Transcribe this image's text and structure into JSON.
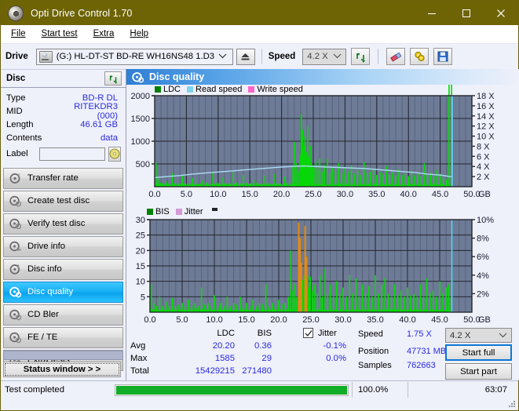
{
  "window": {
    "title": "Opti Drive Control 1.70",
    "icon": "disc-icon",
    "minimize": "minimize-icon",
    "maximize": "maximize-icon",
    "close": "close-icon",
    "titlebar_color": "#6e6405"
  },
  "menu": {
    "items": [
      {
        "label": "File",
        "accel": "F"
      },
      {
        "label": "Start test",
        "accel": "S"
      },
      {
        "label": "Extra",
        "accel": "x"
      },
      {
        "label": "Help",
        "accel": "H"
      }
    ]
  },
  "toolbar": {
    "drive_label": "Drive",
    "drive_value": "(G:)  HL-DT-ST BD-RE  WH16NS48 1.D3",
    "drive_icon": "optical-drive-icon",
    "eject_icon": "eject-icon",
    "speed_label": "Speed",
    "speed_value": "4.2 X",
    "refresh_icon": "refresh-icon",
    "eraser_icon": "eraser-icon",
    "settings_icon": "settings-icon",
    "save_icon": "save-icon"
  },
  "disc_panel": {
    "header": "Disc",
    "refresh_icon": "refresh-disc-icon",
    "rows": [
      {
        "key": "Type",
        "value": "BD-R DL"
      },
      {
        "key": "MID",
        "value": "RITEKDR3 (000)"
      },
      {
        "key": "Length",
        "value": "46.61 GB"
      },
      {
        "key": "Contents",
        "value": "data"
      }
    ],
    "label_key": "Label",
    "label_value": "",
    "label_placeholder": "",
    "label_button_icon": "disc-label-icon"
  },
  "sidebar": {
    "items": [
      {
        "label": "Transfer rate",
        "icon": "disc-test-icon",
        "active": false
      },
      {
        "label": "Create test disc",
        "icon": "disc-create-icon",
        "active": false
      },
      {
        "label": "Verify test disc",
        "icon": "disc-verify-icon",
        "active": false
      },
      {
        "label": "Drive info",
        "icon": "drive-info-icon",
        "active": false
      },
      {
        "label": "Disc info",
        "icon": "disc-info-icon",
        "active": false
      },
      {
        "label": "Disc quality",
        "icon": "disc-quality-icon",
        "active": true
      },
      {
        "label": "CD Bler",
        "icon": "cd-bler-icon",
        "active": false
      },
      {
        "label": "FE / TE",
        "icon": "fe-te-icon",
        "active": false
      },
      {
        "label": "Extra tests",
        "icon": "extra-tests-icon",
        "active": false
      }
    ],
    "status_window_button": "Status window > >"
  },
  "main": {
    "title": "Disc quality",
    "icon": "disc-quality-icon"
  },
  "chart_data": [
    {
      "type": "line",
      "name": "ldc-chart",
      "title": "",
      "xlabel": "GB",
      "ylabel": "",
      "xlim": [
        0,
        50
      ],
      "ylim": [
        0,
        2000
      ],
      "y2lim": [
        0,
        18
      ],
      "y2label": "X",
      "grid": true,
      "legend_position": "top-left",
      "legend": [
        {
          "name": "LDC",
          "color": "#008000"
        },
        {
          "name": "Read speed",
          "color": "#7fd4f0"
        },
        {
          "name": "Write speed",
          "color": "#ff66cc"
        }
      ],
      "xticks": [
        "0.0",
        "5.0",
        "10.0",
        "15.0",
        "20.0",
        "25.0",
        "30.0",
        "35.0",
        "40.0",
        "45.0",
        "50.0"
      ],
      "yticks": [
        500,
        1000,
        1500,
        2000
      ],
      "y2ticks": [
        "2 X",
        "4 X",
        "6 X",
        "8 X",
        "10 X",
        "12 X",
        "14 X",
        "16 X",
        "18 X"
      ],
      "series": [
        {
          "name": "LDC",
          "color": "#00dd00",
          "x": [
            0.2,
            0.5,
            0.9,
            1.3,
            1.8,
            2.3,
            2.8,
            3.3,
            3.9,
            4.4,
            4.9,
            5.4,
            6.0,
            6.5,
            7.0,
            7.6,
            8.1,
            8.6,
            9.2,
            9.7,
            10.2,
            10.8,
            11.3,
            11.8,
            12.4,
            12.9,
            13.4,
            14.0,
            14.5,
            15.0,
            15.6,
            16.1,
            16.6,
            17.2,
            17.7,
            18.2,
            18.8,
            19.3,
            19.8,
            20.4,
            20.9,
            21.4,
            21.8,
            22.0,
            22.3,
            22.6,
            22.9,
            23.1,
            23.3,
            23.5,
            23.7,
            23.9,
            24.1,
            24.3,
            24.5,
            24.7,
            24.9,
            25.1,
            25.4,
            25.7,
            26.0,
            26.4,
            26.8,
            27.2,
            27.6,
            28.0,
            28.5,
            29.0,
            29.5,
            30.0,
            30.5,
            31.0,
            31.5,
            32.0,
            32.5,
            33.0,
            33.5,
            34.0,
            34.5,
            35.0,
            35.5,
            36.0,
            36.5,
            37.0,
            37.5,
            38.0,
            38.5,
            39.0,
            39.5,
            40.0,
            40.5,
            41.0,
            41.5,
            42.0,
            42.5,
            43.0,
            43.5,
            44.0,
            44.5,
            45.0,
            45.5,
            46.0,
            46.4,
            46.8
          ],
          "y": [
            520,
            180,
            90,
            70,
            120,
            60,
            300,
            80,
            60,
            250,
            70,
            60,
            190,
            70,
            60,
            140,
            90,
            60,
            300,
            80,
            70,
            200,
            60,
            60,
            330,
            90,
            70,
            260,
            80,
            70,
            150,
            90,
            60,
            240,
            70,
            60,
            280,
            80,
            70,
            220,
            90,
            70,
            430,
            980,
            520,
            350,
            700,
            1590,
            1250,
            900,
            1100,
            760,
            1330,
            660,
            900,
            520,
            470,
            420,
            560,
            380,
            620,
            330,
            480,
            610,
            300,
            420,
            360,
            520,
            300,
            430,
            330,
            470,
            290,
            380,
            260,
            540,
            300,
            330,
            420,
            260,
            330,
            290,
            450,
            270,
            320,
            240,
            380,
            260,
            300,
            230,
            340,
            250,
            290,
            230,
            520,
            260,
            300,
            240,
            360,
            280,
            200,
            160
          ]
        },
        {
          "name": "Read speed",
          "color": "#aadcf5",
          "x": [
            0.0,
            2.0,
            4.0,
            6.0,
            8.0,
            10.0,
            12.0,
            14.0,
            16.0,
            18.0,
            20.0,
            22.0,
            23.5,
            25.0,
            27.0,
            29.0,
            31.0,
            33.0,
            35.0,
            37.0,
            39.0,
            41.0,
            43.0,
            45.0,
            46.5,
            46.9,
            46.9
          ],
          "y": [
            1.8,
            2.0,
            2.2,
            2.5,
            2.7,
            2.9,
            3.1,
            3.3,
            3.5,
            3.7,
            3.9,
            4.0,
            4.1,
            4.0,
            3.9,
            3.8,
            3.7,
            3.6,
            3.4,
            3.2,
            3.0,
            2.8,
            2.5,
            2.3,
            2.0,
            2.0,
            18.0
          ]
        }
      ]
    },
    {
      "type": "line",
      "name": "bis-jitter-chart",
      "title": "",
      "xlabel": "GB",
      "ylabel": "",
      "xlim": [
        0,
        50
      ],
      "ylim": [
        0,
        30
      ],
      "y2lim": [
        0,
        10
      ],
      "y2label": "%",
      "grid": true,
      "legend_position": "top-left",
      "legend": [
        {
          "name": "BIS",
          "color": "#008000"
        },
        {
          "name": "Jitter",
          "color": "#d49ad4"
        }
      ],
      "xticks": [
        "0.0",
        "5.0",
        "10.0",
        "15.0",
        "20.0",
        "25.0",
        "30.0",
        "35.0",
        "40.0",
        "45.0",
        "50.0"
      ],
      "yticks": [
        5,
        10,
        15,
        20,
        25,
        30
      ],
      "y2ticks": [
        "2%",
        "4%",
        "6%",
        "8%",
        "10%"
      ],
      "series": [
        {
          "name": "BIS",
          "color": "#00dd00",
          "x": [
            0.2,
            0.6,
            1.0,
            1.5,
            2.0,
            2.5,
            3.0,
            3.5,
            4.0,
            4.5,
            5.0,
            5.5,
            6.0,
            6.5,
            7.0,
            7.5,
            8.0,
            8.5,
            9.0,
            9.5,
            10.0,
            10.5,
            11.0,
            11.5,
            12.0,
            12.5,
            13.0,
            13.5,
            14.0,
            14.5,
            15.0,
            15.5,
            16.0,
            16.5,
            17.0,
            17.5,
            18.0,
            18.5,
            19.0,
            19.5,
            20.0,
            20.5,
            21.0,
            21.5,
            21.9,
            22.2,
            22.5,
            22.8,
            23.1,
            23.3,
            23.5,
            23.7,
            23.9,
            24.1,
            24.3,
            24.5,
            24.7,
            24.9,
            25.2,
            25.6,
            26.0,
            26.4,
            26.8,
            27.2,
            27.6,
            28.0,
            28.5,
            29.0,
            29.5,
            30.0,
            30.5,
            31.0,
            31.5,
            32.0,
            32.5,
            33.0,
            33.5,
            34.0,
            34.5,
            35.0,
            35.5,
            36.0,
            36.5,
            37.0,
            37.5,
            38.0,
            38.5,
            39.0,
            39.5,
            40.0,
            40.5,
            41.0,
            41.5,
            42.0,
            42.5,
            43.0,
            43.5,
            44.0,
            44.5,
            45.0,
            45.5,
            46.0,
            46.4,
            46.8
          ],
          "y": [
            9.0,
            3.0,
            2.0,
            5.0,
            2.0,
            3.5,
            2.0,
            4.5,
            2.0,
            2.5,
            3.0,
            2.0,
            4.0,
            2.0,
            3.0,
            2.0,
            8.0,
            2.5,
            3.0,
            2.0,
            5.5,
            2.0,
            3.0,
            2.0,
            5.0,
            2.0,
            3.0,
            2.5,
            5.0,
            2.0,
            3.0,
            2.0,
            4.0,
            2.0,
            3.0,
            2.5,
            9.0,
            2.0,
            3.0,
            2.0,
            4.0,
            2.5,
            3.0,
            5.0,
            20.0,
            7.0,
            9.0,
            5.0,
            29.0,
            24.0,
            16.0,
            10.5,
            12.0,
            28.0,
            18.0,
            12.0,
            8.0,
            11.5,
            7.0,
            9.0,
            6.0,
            12.0,
            5.0,
            14.0,
            6.0,
            9.0,
            5.0,
            10.0,
            6.0,
            8.0,
            5.0,
            12.0,
            6.0,
            11.0,
            5.0,
            9.0,
            6.0,
            8.5,
            5.0,
            12.0,
            6.0,
            9.0,
            11.0,
            6.0,
            5.0,
            9.0,
            5.5,
            7.0,
            5.0,
            8.0,
            5.5,
            6.0,
            5.0,
            9.0,
            5.0,
            11.0,
            6.0,
            7.0,
            5.0,
            10.0,
            6.0,
            8.0,
            9.0,
            5.0
          ]
        },
        {
          "name": "Jitter",
          "color": "#e08a1a",
          "x": [
            23.1,
            23.3,
            23.5,
            24.1,
            24.3
          ],
          "y": [
            29.0,
            24.0,
            16.0,
            28.0,
            18.0
          ]
        }
      ]
    }
  ],
  "stats": {
    "col_headers": [
      "LDC",
      "BIS"
    ],
    "rows": [
      {
        "label": "Avg",
        "ldc": "20.20",
        "bis": "0.36",
        "jitter": "-0.1%"
      },
      {
        "label": "Max",
        "ldc": "1585",
        "bis": "29",
        "jitter": "0.0%"
      },
      {
        "label": "Total",
        "ldc": "15429215",
        "bis": "271480",
        "jitter": ""
      }
    ],
    "jitter_label": "Jitter",
    "jitter_checked": true,
    "speed_label": "Speed",
    "speed_value": "1.75 X",
    "position_label": "Position",
    "position_value": "47731 MB",
    "samples_label": "Samples",
    "samples_value": "762663",
    "speed_select_value": "4.2 X",
    "start_full_label": "Start full",
    "start_part_label": "Start part"
  },
  "statusbar": {
    "message": "Test completed",
    "progress_percent": "100.0%",
    "progress_value": 100,
    "elapsed": "63:07",
    "grip_icon": "resize-grip-icon",
    "progress_color": "#12ad26"
  }
}
